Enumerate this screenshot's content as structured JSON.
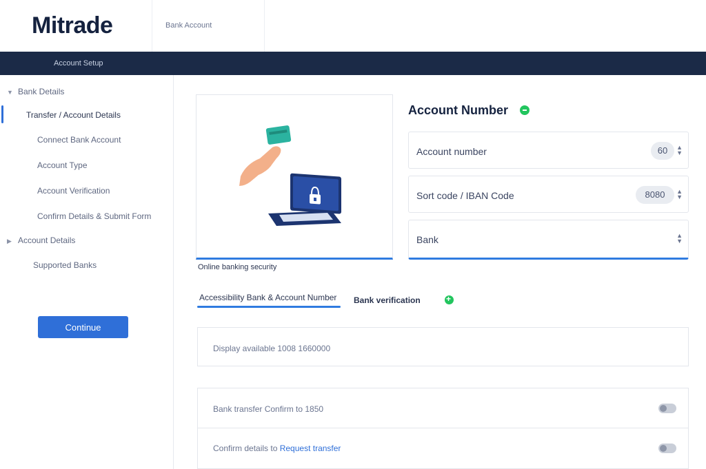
{
  "header": {
    "logo": "Mitrade",
    "subtitle": "Bank Account"
  },
  "navbar": {
    "label": "Account Setup"
  },
  "sidebar": {
    "groups": [
      {
        "label": "Bank Details",
        "items": [
          {
            "label": "Transfer / Account Details",
            "active": true
          },
          {
            "label": "Connect Bank Account",
            "active": false
          },
          {
            "label": "Account Type",
            "active": false
          },
          {
            "label": "Account Verification",
            "active": false
          },
          {
            "label": "Confirm Details & Submit Form",
            "active": false
          }
        ]
      },
      {
        "label": "Account Details",
        "items": [
          {
            "label": "Supported Banks",
            "active": false
          }
        ]
      }
    ],
    "button_label": "Continue"
  },
  "illustration": {
    "caption": "Online banking security"
  },
  "account": {
    "title": "Account Number",
    "fields": [
      {
        "label": "Account number",
        "value": "60"
      },
      {
        "label": "Sort code / IBAN Code",
        "value": "8080"
      },
      {
        "label": "Bank",
        "value": ""
      }
    ]
  },
  "tabs": [
    {
      "label": "Accessibility Bank & Account Number",
      "active": true
    },
    {
      "label": "Bank verification",
      "active": false
    }
  ],
  "panels": [
    {
      "text": "Display available 1008 1660000"
    },
    {
      "text": "Bank transfer Confirm to 1850",
      "toggle": "off"
    },
    {
      "text_prefix": "Confirm details to ",
      "text_accent": "Request transfer",
      "toggle": "off"
    }
  ],
  "colors": {
    "navbar": "#1b2a47",
    "accent": "#2f7be0",
    "primary_button": "#2f6fd8",
    "status_green": "#22c55e"
  },
  "icons": {
    "sidebar_group": "chevron-down-icon",
    "status": "check-circle-icon",
    "tab_status": "plus-circle-icon",
    "stepper": "chevron-updown-icon"
  }
}
